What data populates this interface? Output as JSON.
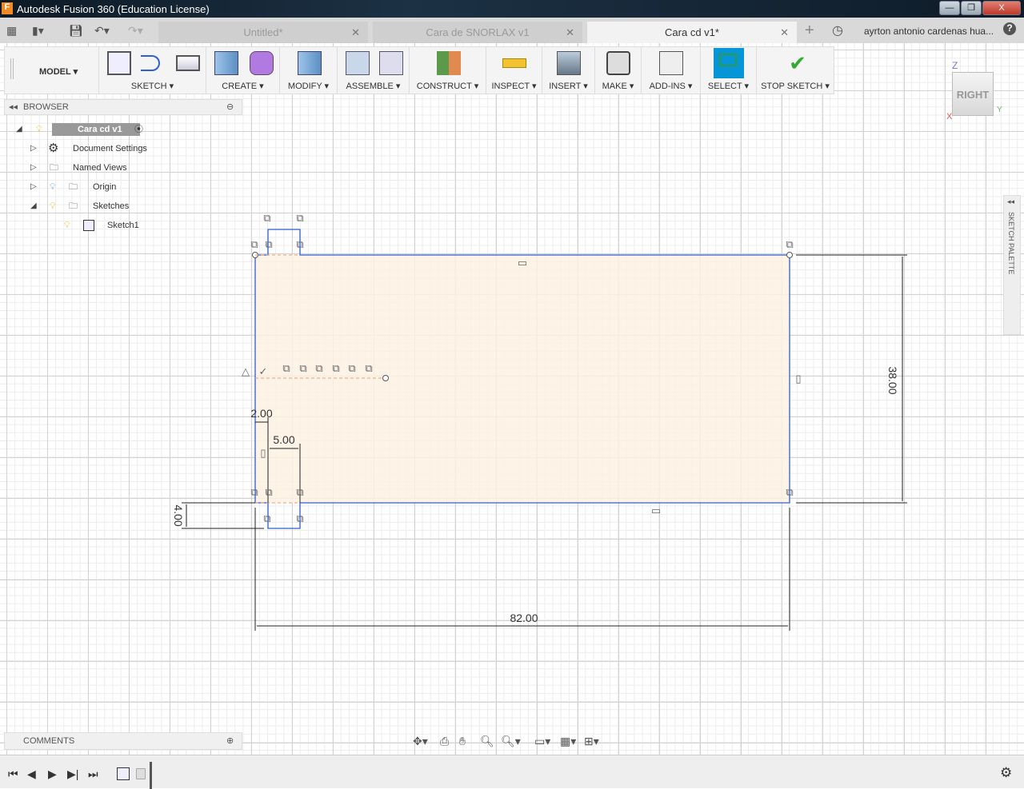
{
  "window": {
    "title": "Autodesk Fusion 360 (Education License)",
    "logo": "F",
    "minimize": "—",
    "restore": "❐",
    "close": "X"
  },
  "tabs": [
    {
      "label": "Untitled*",
      "active": false
    },
    {
      "label": "Cara de SNORLAX v1",
      "active": false
    },
    {
      "label": "Cara cd v1*",
      "active": true
    }
  ],
  "user": "ayrton antonio cardenas hua...",
  "help": "?",
  "toolbar": {
    "workspace": "MODEL ▾",
    "groups": [
      "SKETCH ▾",
      "CREATE ▾",
      "MODIFY ▾",
      "ASSEMBLE ▾",
      "CONSTRUCT ▾",
      "INSPECT ▾",
      "INSERT ▾",
      "MAKE ▾",
      "ADD-INS ▾",
      "SELECT ▾",
      "STOP SKETCH ▾"
    ],
    "accent": "#0696d7"
  },
  "browser": {
    "title": "BROWSER",
    "items": [
      {
        "label": "Cara cd v1"
      },
      {
        "label": "Document Settings"
      },
      {
        "label": "Named Views"
      },
      {
        "label": "Origin"
      },
      {
        "label": "Sketches"
      },
      {
        "label": "Sketch1"
      }
    ]
  },
  "comments": {
    "title": "COMMENTS"
  },
  "viewcube": {
    "face": "RIGHT",
    "axis_z": "Z",
    "axis_x": "X",
    "axis_y": "Y"
  },
  "palette": {
    "label": "SKETCH PALETTE"
  },
  "sketch": {
    "dimensions": {
      "height": "38.00",
      "width": "82.00",
      "tab_height": "4.00",
      "offset": "2.00",
      "tab_width": "5.00"
    },
    "line_color": "#2f5fd0",
    "fill_color": "#fdf1e3"
  }
}
